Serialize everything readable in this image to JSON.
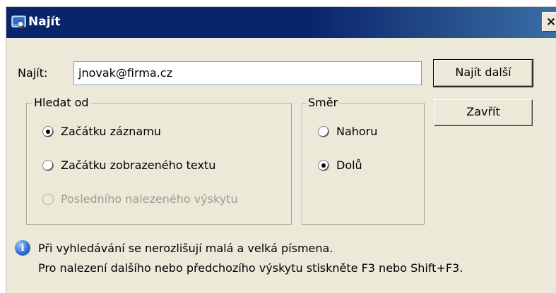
{
  "window": {
    "title": "Najít",
    "close_glyph": "×"
  },
  "find": {
    "label": "Najít:",
    "value": "jnovak@firma.cz"
  },
  "buttons": {
    "find_next": "Najít další",
    "close": "Zavřít"
  },
  "search_from": {
    "title": "Hledat od",
    "options": [
      {
        "label": "Začátku záznamu",
        "checked": true,
        "enabled": true
      },
      {
        "label": "Začátku zobrazeného textu",
        "checked": false,
        "enabled": true
      },
      {
        "label": "Posledního nalezeného výskytu",
        "checked": false,
        "enabled": false
      }
    ]
  },
  "direction": {
    "title": "Směr",
    "options": [
      {
        "label": "Nahoru",
        "checked": false,
        "enabled": true
      },
      {
        "label": "Dolů",
        "checked": true,
        "enabled": true
      }
    ]
  },
  "info": {
    "icon": "info-icon",
    "line1": "Při vyhledávání se nerozlišují malá a velká písmena.",
    "line2": "Pro nalezení dalšího nebo předchozího výskytu stiskněte F3 nebo Shift+F3."
  }
}
